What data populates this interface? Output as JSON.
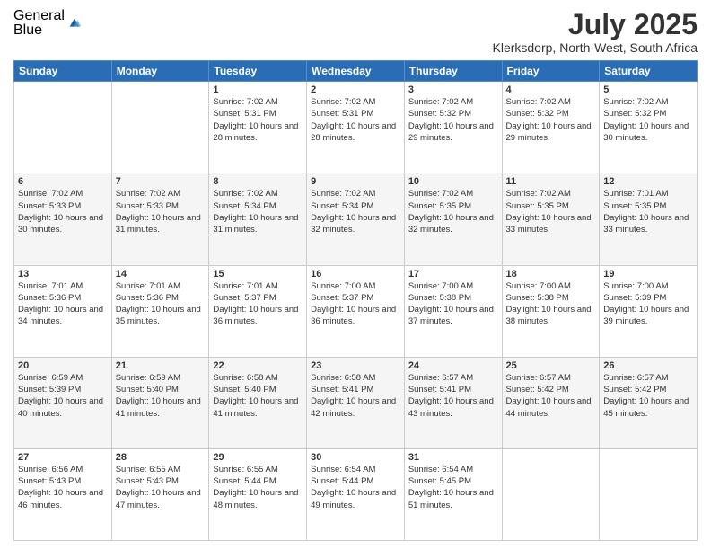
{
  "logo": {
    "general": "General",
    "blue": "Blue"
  },
  "title": "July 2025",
  "location": "Klerksdorp, North-West, South Africa",
  "days_header": [
    "Sunday",
    "Monday",
    "Tuesday",
    "Wednesday",
    "Thursday",
    "Friday",
    "Saturday"
  ],
  "weeks": [
    [
      {
        "day": "",
        "info": ""
      },
      {
        "day": "",
        "info": ""
      },
      {
        "day": "1",
        "sunrise": "7:02 AM",
        "sunset": "5:31 PM",
        "daylight": "10 hours and 28 minutes."
      },
      {
        "day": "2",
        "sunrise": "7:02 AM",
        "sunset": "5:31 PM",
        "daylight": "10 hours and 28 minutes."
      },
      {
        "day": "3",
        "sunrise": "7:02 AM",
        "sunset": "5:32 PM",
        "daylight": "10 hours and 29 minutes."
      },
      {
        "day": "4",
        "sunrise": "7:02 AM",
        "sunset": "5:32 PM",
        "daylight": "10 hours and 29 minutes."
      },
      {
        "day": "5",
        "sunrise": "7:02 AM",
        "sunset": "5:32 PM",
        "daylight": "10 hours and 30 minutes."
      }
    ],
    [
      {
        "day": "6",
        "sunrise": "7:02 AM",
        "sunset": "5:33 PM",
        "daylight": "10 hours and 30 minutes."
      },
      {
        "day": "7",
        "sunrise": "7:02 AM",
        "sunset": "5:33 PM",
        "daylight": "10 hours and 31 minutes."
      },
      {
        "day": "8",
        "sunrise": "7:02 AM",
        "sunset": "5:34 PM",
        "daylight": "10 hours and 31 minutes."
      },
      {
        "day": "9",
        "sunrise": "7:02 AM",
        "sunset": "5:34 PM",
        "daylight": "10 hours and 32 minutes."
      },
      {
        "day": "10",
        "sunrise": "7:02 AM",
        "sunset": "5:35 PM",
        "daylight": "10 hours and 32 minutes."
      },
      {
        "day": "11",
        "sunrise": "7:02 AM",
        "sunset": "5:35 PM",
        "daylight": "10 hours and 33 minutes."
      },
      {
        "day": "12",
        "sunrise": "7:01 AM",
        "sunset": "5:35 PM",
        "daylight": "10 hours and 33 minutes."
      }
    ],
    [
      {
        "day": "13",
        "sunrise": "7:01 AM",
        "sunset": "5:36 PM",
        "daylight": "10 hours and 34 minutes."
      },
      {
        "day": "14",
        "sunrise": "7:01 AM",
        "sunset": "5:36 PM",
        "daylight": "10 hours and 35 minutes."
      },
      {
        "day": "15",
        "sunrise": "7:01 AM",
        "sunset": "5:37 PM",
        "daylight": "10 hours and 36 minutes."
      },
      {
        "day": "16",
        "sunrise": "7:00 AM",
        "sunset": "5:37 PM",
        "daylight": "10 hours and 36 minutes."
      },
      {
        "day": "17",
        "sunrise": "7:00 AM",
        "sunset": "5:38 PM",
        "daylight": "10 hours and 37 minutes."
      },
      {
        "day": "18",
        "sunrise": "7:00 AM",
        "sunset": "5:38 PM",
        "daylight": "10 hours and 38 minutes."
      },
      {
        "day": "19",
        "sunrise": "7:00 AM",
        "sunset": "5:39 PM",
        "daylight": "10 hours and 39 minutes."
      }
    ],
    [
      {
        "day": "20",
        "sunrise": "6:59 AM",
        "sunset": "5:39 PM",
        "daylight": "10 hours and 40 minutes."
      },
      {
        "day": "21",
        "sunrise": "6:59 AM",
        "sunset": "5:40 PM",
        "daylight": "10 hours and 41 minutes."
      },
      {
        "day": "22",
        "sunrise": "6:58 AM",
        "sunset": "5:40 PM",
        "daylight": "10 hours and 41 minutes."
      },
      {
        "day": "23",
        "sunrise": "6:58 AM",
        "sunset": "5:41 PM",
        "daylight": "10 hours and 42 minutes."
      },
      {
        "day": "24",
        "sunrise": "6:57 AM",
        "sunset": "5:41 PM",
        "daylight": "10 hours and 43 minutes."
      },
      {
        "day": "25",
        "sunrise": "6:57 AM",
        "sunset": "5:42 PM",
        "daylight": "10 hours and 44 minutes."
      },
      {
        "day": "26",
        "sunrise": "6:57 AM",
        "sunset": "5:42 PM",
        "daylight": "10 hours and 45 minutes."
      }
    ],
    [
      {
        "day": "27",
        "sunrise": "6:56 AM",
        "sunset": "5:43 PM",
        "daylight": "10 hours and 46 minutes."
      },
      {
        "day": "28",
        "sunrise": "6:55 AM",
        "sunset": "5:43 PM",
        "daylight": "10 hours and 47 minutes."
      },
      {
        "day": "29",
        "sunrise": "6:55 AM",
        "sunset": "5:44 PM",
        "daylight": "10 hours and 48 minutes."
      },
      {
        "day": "30",
        "sunrise": "6:54 AM",
        "sunset": "5:44 PM",
        "daylight": "10 hours and 49 minutes."
      },
      {
        "day": "31",
        "sunrise": "6:54 AM",
        "sunset": "5:45 PM",
        "daylight": "10 hours and 51 minutes."
      },
      {
        "day": "",
        "info": ""
      },
      {
        "day": "",
        "info": ""
      }
    ]
  ],
  "labels": {
    "sunrise": "Sunrise: ",
    "sunset": "Sunset: ",
    "daylight": "Daylight: "
  }
}
